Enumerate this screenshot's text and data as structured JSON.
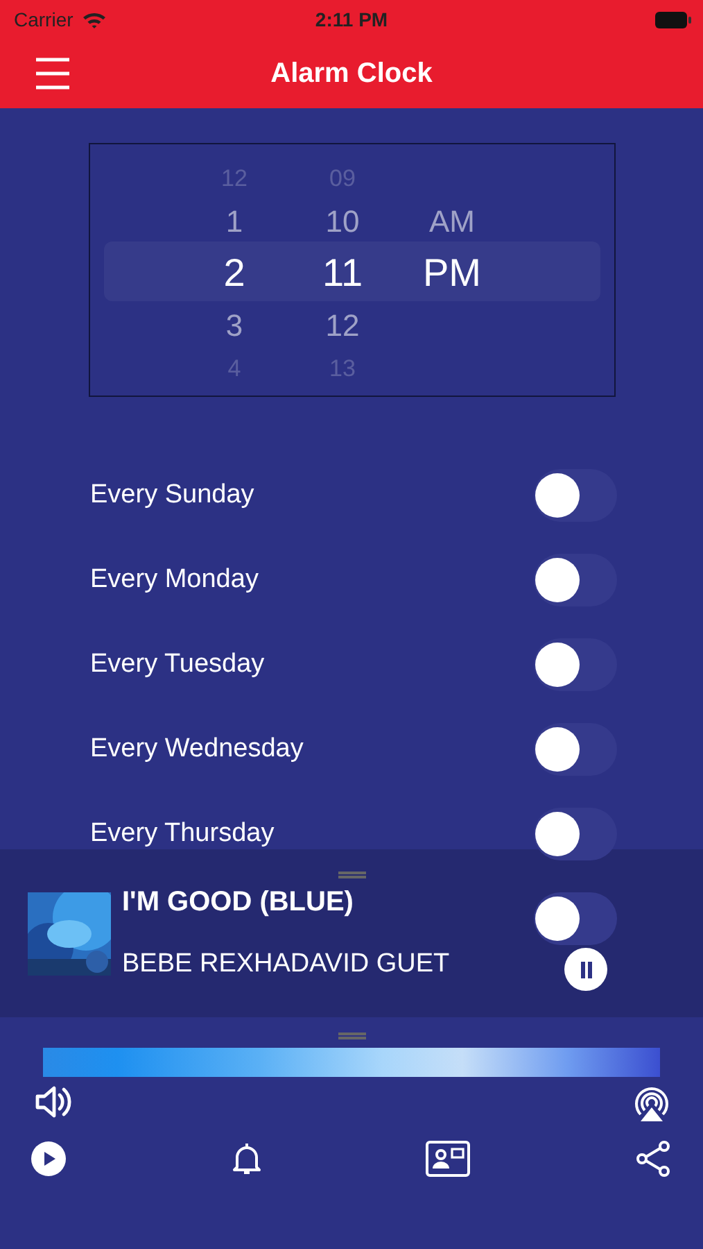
{
  "status_bar": {
    "carrier": "Carrier",
    "time": "2:11 PM"
  },
  "header": {
    "title": "Alarm Clock"
  },
  "picker": {
    "columns": [
      {
        "kind": "hour",
        "items": [
          {
            "label": "12",
            "selected": false
          },
          {
            "label": "1",
            "selected": false
          },
          {
            "label": "2",
            "selected": true
          },
          {
            "label": "3",
            "selected": false
          },
          {
            "label": "4",
            "selected": false
          }
        ]
      },
      {
        "kind": "minute",
        "items": [
          {
            "label": "09",
            "selected": false
          },
          {
            "label": "10",
            "selected": false
          },
          {
            "label": "11",
            "selected": true
          },
          {
            "label": "12",
            "selected": false
          },
          {
            "label": "13",
            "selected": false
          }
        ]
      },
      {
        "kind": "period",
        "items": [
          {
            "label": "AM",
            "selected": false
          },
          {
            "label": "PM",
            "selected": true
          }
        ]
      }
    ]
  },
  "repeat_days": [
    {
      "label": "Every Sunday",
      "on": false
    },
    {
      "label": "Every Monday",
      "on": false
    },
    {
      "label": "Every Tuesday",
      "on": false
    },
    {
      "label": "Every Wednesday",
      "on": false
    },
    {
      "label": "Every Thursday",
      "on": false
    },
    {
      "on": false
    }
  ],
  "now_playing": {
    "title": "I'M GOOD (BLUE)",
    "artist": "BEBE REXHADAVID GUET",
    "playing": true
  }
}
